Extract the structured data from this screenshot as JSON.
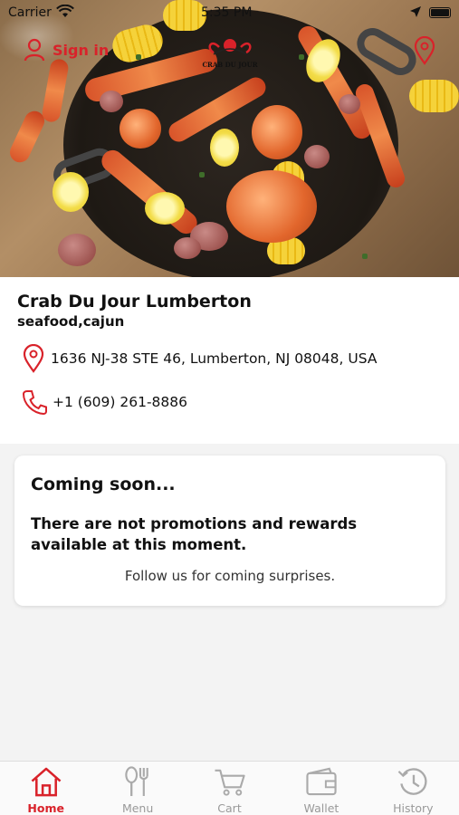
{
  "status_bar": {
    "carrier": "Carrier",
    "time": "5:35 PM"
  },
  "header": {
    "sign_in_label": "Sign in",
    "logo_text": "CRAB DU JOUR"
  },
  "restaurant": {
    "name": "Crab Du Jour Lumberton",
    "categories": "seafood,cajun",
    "address": "1636 NJ-38 STE 46,  Lumberton, NJ 08048, USA",
    "phone": "+1 (609) 261-8886"
  },
  "promo": {
    "title": "Coming soon...",
    "message": "There are not promotions and rewards available at this moment.",
    "follow_text": "Follow us for coming surprises."
  },
  "tabs": [
    {
      "label": "Home",
      "icon": "home-icon",
      "active": true
    },
    {
      "label": "Menu",
      "icon": "fork-knife-icon",
      "active": false
    },
    {
      "label": "Cart",
      "icon": "cart-icon",
      "active": false
    },
    {
      "label": "Wallet",
      "icon": "wallet-icon",
      "active": false
    },
    {
      "label": "History",
      "icon": "history-icon",
      "active": false
    }
  ],
  "colors": {
    "accent": "#d9222a",
    "inactive": "#999999",
    "background": "#f3f3f3"
  }
}
